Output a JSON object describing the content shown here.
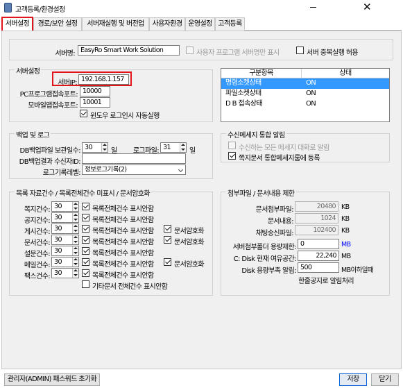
{
  "window": {
    "title": "고객등록/환경설정"
  },
  "tabs": [
    {
      "label": "서버설정",
      "active": true
    },
    {
      "label": "경로/보안 설정"
    },
    {
      "label": "서버재실행 및 버전업"
    },
    {
      "label": "사용자환경"
    },
    {
      "label": "운영설정"
    },
    {
      "label": "고객등록"
    }
  ],
  "server": {
    "name_label": "서버명:",
    "name_value": "EasyRo Smart Work Solution",
    "show_name_label": "사용자 프로그램 서버명만 표시",
    "allow_dup_label": "서버 중복실행 허용",
    "group_title": "서버설정",
    "ip_label": "서버IP:",
    "ip_value": "192.168.1.157",
    "pc_port_label": "PC프로그램접속포트:",
    "pc_port_value": "10000",
    "mobile_port_label": "모바일앱접속포트:",
    "mobile_port_value": "10001",
    "windows_login_label": "윈도우 로그인시 자동실행"
  },
  "status_table": {
    "headers": [
      "구분항목",
      "상태"
    ],
    "rows": [
      {
        "item": "명령소켓상태",
        "status": "ON"
      },
      {
        "item": "파일소켓상태",
        "status": "ON"
      },
      {
        "item": "D B 접속상태",
        "status": "ON"
      }
    ]
  },
  "backup": {
    "title": "백업 및 로그",
    "db_keep_label": "DB백업파일 보관일수:",
    "db_keep_value": "30",
    "day_unit": "일",
    "log_file_label": "로그파일:",
    "log_file_value": "31",
    "db_recv_label": "DB백업결과 수신자ID:",
    "db_recv_value": "",
    "log_level_label": "로그기록레벨:",
    "log_level_value": "정보로그기록(2)"
  },
  "integrated": {
    "title": "수신메세지 통합 알림",
    "opt1": "수신하는 모든 메세지 대화로 알림",
    "opt2": "쪽지문서 통합메세지룸에 등록"
  },
  "counts": {
    "title": "목록 자료건수 / 목록전체건수 미표시 / 문서암호화",
    "rows": [
      {
        "label": "쪽지건수:",
        "value": "30",
        "chk_label": "목록전체건수 표시안함",
        "enc": null
      },
      {
        "label": "공지건수:",
        "value": "30",
        "chk_label": "목록전체건수 표시안함",
        "enc": null
      },
      {
        "label": "게시건수:",
        "value": "30",
        "chk_label": "목록전체건수 표시안함",
        "enc": "문서암호화"
      },
      {
        "label": "문서건수:",
        "value": "30",
        "chk_label": "목록전체건수 표시안함",
        "enc": "문서암호화"
      },
      {
        "label": "설문건수:",
        "value": "30",
        "chk_label": "목록전체건수 표시안함",
        "enc": null
      },
      {
        "label": "메일건수:",
        "value": "30",
        "chk_label": "목록전체건수 표시안함",
        "enc": "문서암호화"
      },
      {
        "label": "팩스건수:",
        "value": "30",
        "chk_label": "목록전체건수 표시안함",
        "enc": null
      }
    ],
    "other_label": "기타문서 전체건수 표시안함"
  },
  "attach": {
    "title": "첨부파일 / 문서내용 제한",
    "doc_attach_label": "문서첨부파일:",
    "doc_attach_value": "20480",
    "doc_content_label": "문서내용:",
    "doc_content_value": "1024",
    "chat_file_label": "채팅송신파일:",
    "chat_file_value": "102400",
    "kb": "KB",
    "folder_limit_label": "서버첨부폴더 용량제한:",
    "folder_limit_value": "0",
    "folder_limit_unit": "MB",
    "disk_avail_label": "C: Disk 현재 여유공간:",
    "disk_avail_value": "22,240",
    "mb": "MB",
    "disk_alarm_label": "Disk 용량부족 알림:",
    "disk_alarm_value": "500",
    "disk_alarm_unit": "MB이하일때",
    "notice_label": "한줄공지로 알림처리"
  },
  "buttons": {
    "reset_pw": "관리자(ADMIN) 패스워드 초기화",
    "save": "저장",
    "close": "닫기"
  },
  "colors": {
    "highlight_red": "#e0141b",
    "selection_blue": "#3399ff",
    "mb_blue": "#0000ff"
  }
}
